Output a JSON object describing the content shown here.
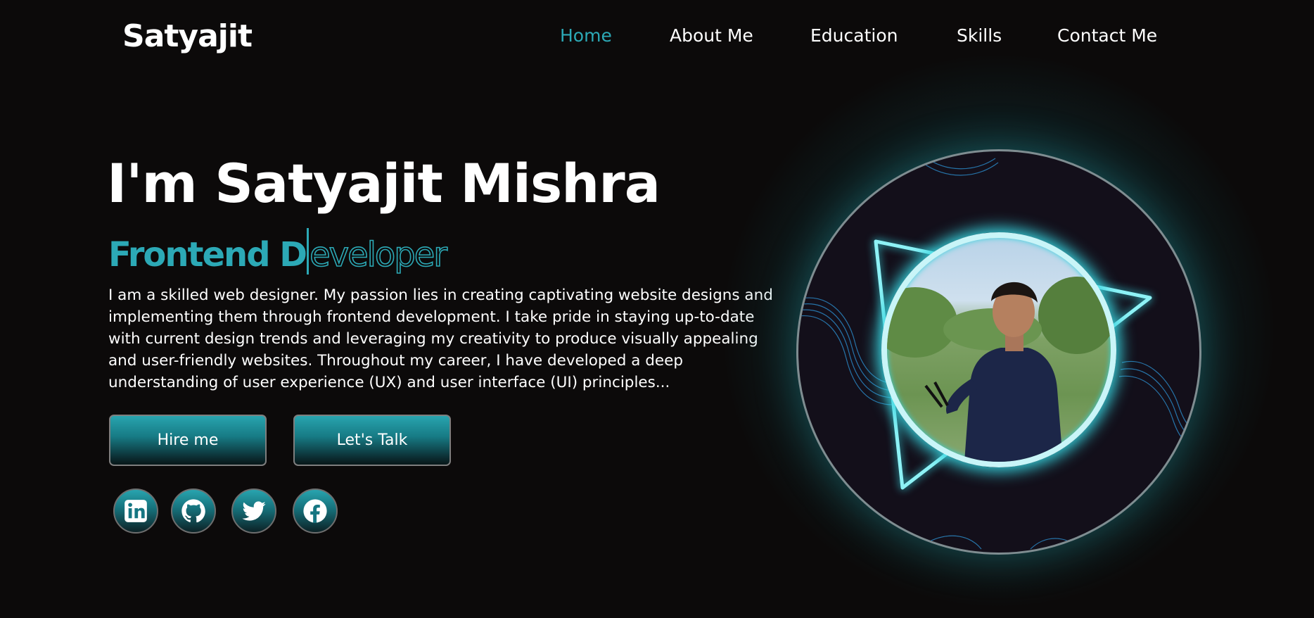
{
  "header": {
    "logo": "Satyajit",
    "nav": [
      {
        "label": "Home",
        "active": true
      },
      {
        "label": "About Me",
        "active": false
      },
      {
        "label": "Education",
        "active": false
      },
      {
        "label": "Skills",
        "active": false
      },
      {
        "label": "Contact Me",
        "active": false
      }
    ]
  },
  "hero": {
    "title": "I'm Satyajit Mishra",
    "subtitle_typed": "Frontend D",
    "subtitle_rest": "eveloper",
    "description": "I am a skilled web designer. My passion lies in creating captivating website designs and implementing them through frontend development. I take pride in staying up-to-date with current design trends and leveraging my creativity to produce visually appealing and user-friendly websites. Throughout my career, I have developed a deep understanding of user experience (UX) and user interface (UI) principles...",
    "buttons": {
      "hire": "Hire me",
      "talk": "Let's Talk"
    }
  },
  "social": [
    "linkedin-icon",
    "github-icon",
    "twitter-icon",
    "facebook-icon"
  ],
  "colors": {
    "accent": "#2ca9b6",
    "background": "#0c0a0a",
    "glow": "#37d4df"
  }
}
